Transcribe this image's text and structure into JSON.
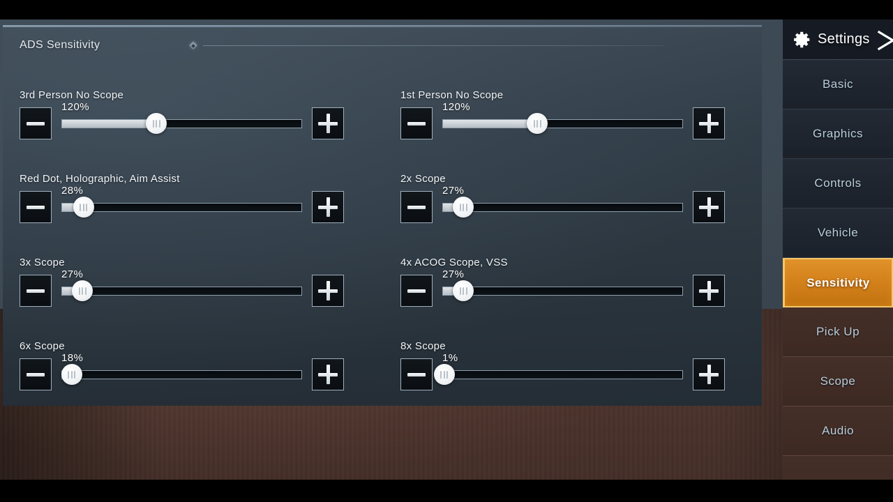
{
  "section": {
    "title": "ADS Sensitivity",
    "marker_icon": "diamond-marker-icon"
  },
  "sliders": {
    "left": [
      {
        "label": "3rd Person No Scope",
        "value": "120%",
        "percent": 39.5,
        "fill_percent": 39.5,
        "minus_icon": "minus-icon",
        "plus_icon": "plus-icon"
      },
      {
        "label": "Red Dot, Holographic, Aim Assist",
        "value": "28%",
        "percent": 9.0,
        "fill_percent": 8.0,
        "minus_icon": "minus-icon",
        "plus_icon": "plus-icon"
      },
      {
        "label": "3x Scope",
        "value": "27%",
        "percent": 8.5,
        "fill_percent": 7.5,
        "minus_icon": "minus-icon",
        "plus_icon": "plus-icon"
      },
      {
        "label": "6x Scope",
        "value": "18%",
        "percent": 4.0,
        "fill_percent": 3.0,
        "minus_icon": "minus-icon",
        "plus_icon": "plus-icon"
      }
    ],
    "right": [
      {
        "label": "1st Person No Scope",
        "value": "120%",
        "percent": 39.5,
        "fill_percent": 39.5,
        "minus_icon": "minus-icon",
        "plus_icon": "plus-icon"
      },
      {
        "label": "2x Scope",
        "value": "27%",
        "percent": 8.5,
        "fill_percent": 7.5,
        "minus_icon": "minus-icon",
        "plus_icon": "plus-icon"
      },
      {
        "label": "4x ACOG Scope, VSS",
        "value": "27%",
        "percent": 8.5,
        "fill_percent": 7.5,
        "minus_icon": "minus-icon",
        "plus_icon": "plus-icon"
      },
      {
        "label": "8x Scope",
        "value": "1%",
        "percent": 0.5,
        "fill_percent": 0.0,
        "minus_icon": "minus-icon",
        "plus_icon": "plus-icon"
      }
    ]
  },
  "sidebar": {
    "title": "Settings",
    "gear_icon": "gear-icon",
    "close_icon": "close-icon",
    "items": [
      {
        "label": "Basic",
        "active": false
      },
      {
        "label": "Graphics",
        "active": false
      },
      {
        "label": "Controls",
        "active": false
      },
      {
        "label": "Vehicle",
        "active": false
      },
      {
        "label": "Sensitivity",
        "active": true
      },
      {
        "label": "Pick Up",
        "active": false
      },
      {
        "label": "Scope",
        "active": false
      },
      {
        "label": "Audio",
        "active": false
      },
      {
        "label": "",
        "active": false
      }
    ]
  },
  "colors": {
    "accent": "#d4821c",
    "accent_border": "#f6c66a",
    "panel_bg": "#2a343d",
    "sidebar_bg": "#1a2029",
    "menu_text": "#b9cedd",
    "track_fill": "#dfe3e7",
    "backdrop_wood": "#4e352c"
  }
}
